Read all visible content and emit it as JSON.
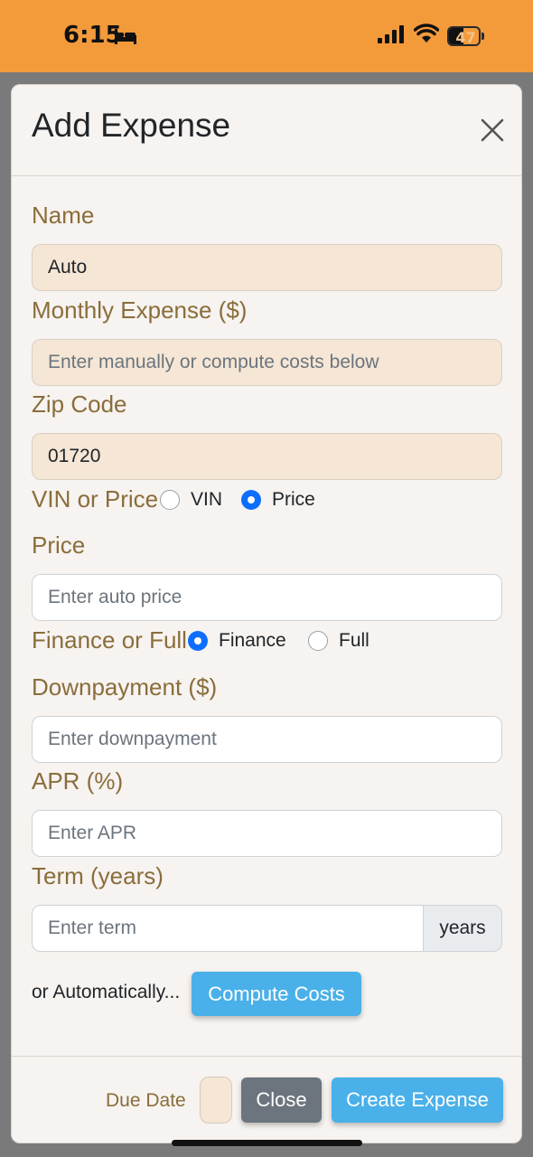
{
  "status_bar": {
    "time": "6:15",
    "battery_level": "47",
    "battery_fraction": 0.47,
    "icons": [
      "bed-icon",
      "cellular-signal-icon",
      "wifi-icon",
      "battery-icon"
    ],
    "background": "#f39a3b"
  },
  "modal": {
    "title": "Add Expense",
    "close_icon": "close-icon",
    "name": {
      "label": "Name",
      "value": "Auto"
    },
    "monthly_expense": {
      "label": "Monthly Expense ($)",
      "placeholder": "Enter manually or compute costs below"
    },
    "zip_code": {
      "label": "Zip Code",
      "value": "01720"
    },
    "vin_or_price": {
      "label": "VIN or Price",
      "options": [
        {
          "label": "VIN",
          "selected": false
        },
        {
          "label": "Price",
          "selected": true
        }
      ]
    },
    "price": {
      "label": "Price",
      "placeholder": "Enter auto price"
    },
    "finance_or_full": {
      "label": "Finance or Full",
      "options": [
        {
          "label": "Finance",
          "selected": true
        },
        {
          "label": "Full",
          "selected": false
        }
      ]
    },
    "downpayment": {
      "label": "Downpayment ($)",
      "placeholder": "Enter downpayment"
    },
    "apr": {
      "label": "APR (%)",
      "placeholder": "Enter APR"
    },
    "term": {
      "label": "Term (years)",
      "placeholder": "Enter term",
      "addon": "years"
    },
    "auto_text": "or Automatically...",
    "compute_button": "Compute Costs",
    "footer": {
      "due_date_label": "Due Date",
      "close_button": "Close",
      "create_button": "Create Expense"
    }
  },
  "colors": {
    "accent": "#4ab0e9",
    "label": "#8a6d3b",
    "tan_field": "#f5e6d5",
    "radio_selected": "#0d6efd",
    "secondary_button": "#6c757d"
  }
}
